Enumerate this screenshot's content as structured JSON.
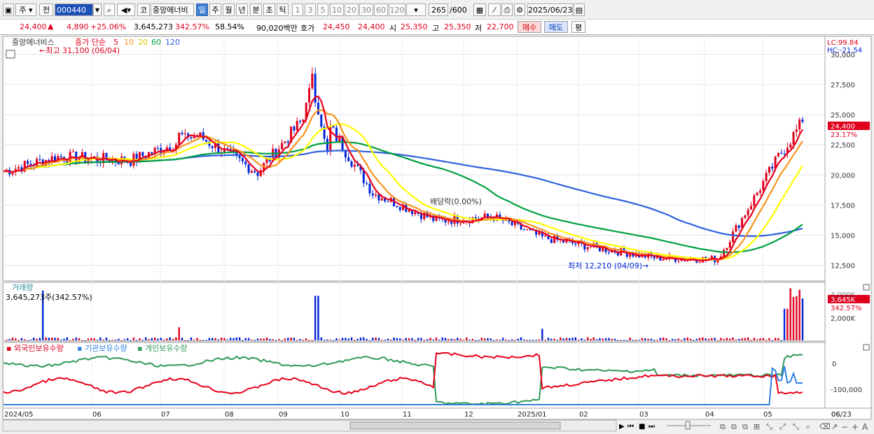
{
  "toolbar": {
    "market": "주",
    "scope": "전",
    "code": "000440",
    "exchange_tag": "코",
    "name": "중앙에너비",
    "periods": [
      "일",
      "주",
      "월",
      "년",
      "분",
      "초",
      "틱"
    ],
    "active_period": "일",
    "minutes": [
      "1",
      "3",
      "5",
      "10",
      "20",
      "30",
      "60",
      "120"
    ],
    "count": "265",
    "count_max": "/600",
    "date": "2025/06/23"
  },
  "quote": {
    "price": "24,400",
    "change": "4,890",
    "change_pct": "+25.06%",
    "volume": "3,645,273",
    "volume_ratio": "342.57%",
    "turnover_pct": "58.54%",
    "amount": "90,020백만",
    "ask_label": "호가",
    "ask": "24,450",
    "bid": "24,400",
    "open_label": "시",
    "open": "25,350",
    "high_label": "고",
    "high": "25,350",
    "low_label": "저",
    "low": "22,700",
    "buy": "매수",
    "sell": "매도",
    "eval": "평"
  },
  "colors": {
    "up": "#e0001c",
    "down": "#0025d8",
    "ma5": "#e8001c",
    "ma10": "#f7941d",
    "ma20": "#ffff00",
    "ma60": "#00a040",
    "ma120": "#2f60e0",
    "foreign": "#e8001c",
    "institution": "#2f7fe0",
    "individual": "#2e9a56"
  },
  "chart_data": [
    {
      "type": "line",
      "legend_title": "중앙에너비스",
      "legend_ma": [
        "종가 단순",
        "5",
        "10",
        "20",
        "60",
        "120"
      ],
      "ylim": [
        11200,
        31500
      ],
      "yticks": [
        "30,000",
        "27,500",
        "25,000",
        "22,500",
        "20,000",
        "17,500",
        "15,000",
        "12,500"
      ],
      "last_price_label": "24,400",
      "last_pct_label": "23.17%",
      "lc_label": "LC:99.84",
      "hc_label": "HC:-21.54",
      "high_marker": "최고 31,100 (06/04)",
      "low_marker": "최저 12,210 (04/09)",
      "dividend_marker": "배당락(0.00%)",
      "x_labels": [
        "2024/05",
        "06",
        "07",
        "08",
        "09",
        "10",
        "11",
        "12",
        "2025/01",
        "02",
        "03",
        "04",
        "05",
        "06",
        "06/23"
      ],
      "close": [
        {
          "label": "2024/05",
          "value": 20300
        },
        {
          "label": "06",
          "value": 21500
        },
        {
          "label": "07",
          "value": 21200
        },
        {
          "label": "08",
          "value": 23300
        },
        {
          "label": "09",
          "value": 20200
        },
        {
          "label": "10",
          "value": 25800
        },
        {
          "label": "11",
          "value": 18500
        },
        {
          "label": "12",
          "value": 16200
        },
        {
          "label": "2025/01",
          "value": 16500
        },
        {
          "label": "02",
          "value": 14800
        },
        {
          "label": "03",
          "value": 13900
        },
        {
          "label": "04",
          "value": 13100
        },
        {
          "label": "05",
          "value": 13000
        },
        {
          "label": "06",
          "value": 21500
        },
        {
          "label": "06/23",
          "value": 24400
        }
      ]
    },
    {
      "type": "bar",
      "title": "거래량",
      "value_label": "3,645,273주(342.57%)",
      "yticks": [
        "4,000K",
        "2,000K"
      ],
      "last_label": "3,645K",
      "last_pct": "342.57%",
      "last_value": 3645273
    },
    {
      "type": "line",
      "series_names": [
        "외국인보유수량",
        "기관보유수량",
        "개인보유수량"
      ],
      "yticks": [
        "0",
        "-100,000"
      ]
    }
  ]
}
